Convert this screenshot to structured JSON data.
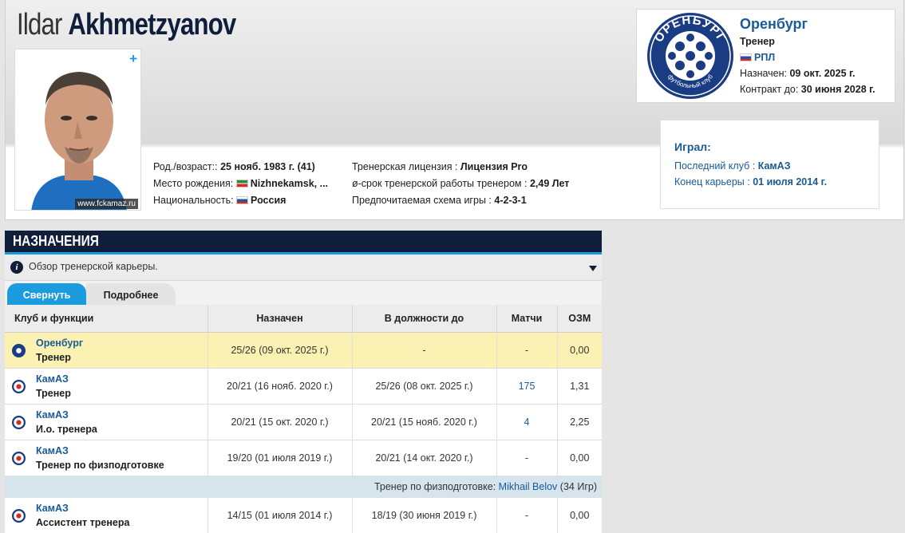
{
  "coach": {
    "first_name": "Ildar",
    "last_name": "Akhmetzyanov",
    "photo_credit": "www.fckamaz.ru",
    "plus": "+"
  },
  "info_left": [
    {
      "label": "Род./возраст::",
      "value": "25 нояб. 1983 г. (41)",
      "flag": ""
    },
    {
      "label": "Место рождения:",
      "value": "Nizhnekamsk, ...",
      "flag": "tatarstan-flag"
    },
    {
      "label": "Национальность:",
      "value": "Россия",
      "flag": "russia-flag"
    }
  ],
  "info_right": [
    {
      "label": "Тренерская лицензия :",
      "value": "Лицензия Pro"
    },
    {
      "label": "ø-срок тренерской работы тренером :",
      "value": "2,49 Лет"
    },
    {
      "label": "Предпочитаемая схема игры :",
      "value": "4-2-3-1"
    }
  ],
  "current_club": {
    "name": "Оренбург",
    "role": "Тренер",
    "league": "РПЛ",
    "appointed_label": "Назначен:",
    "appointed": "09 окт. 2025 г.",
    "contract_label": "Контракт до:",
    "contract": "30 июня 2028 г.",
    "logo_text_top": "ОРЕНБУРГ",
    "logo_text_bottom": "футбольный клуб",
    "logo_year_left": "19",
    "logo_year_right": "76"
  },
  "played": {
    "title": "Играл:",
    "last_club_label": "Последний клуб :",
    "last_club": "КамАЗ",
    "career_end_label": "Конец карьеры :",
    "career_end": "01 июля 2014 г."
  },
  "section": {
    "title": "НАЗНАЧЕНИЯ",
    "overview": "Обзор тренерской карьеры.",
    "tab_collapse": "Свернуть",
    "tab_more": "Подробнее"
  },
  "table": {
    "headers": [
      "Клуб и функции",
      "Назначен",
      "В должности до",
      "Матчи",
      "ОЗМ"
    ],
    "rows": [
      {
        "club": "Оренбург",
        "role": "Тренер",
        "appointed": "25/26 (09 окт. 2025 г.)",
        "until": "-",
        "matches": "-",
        "ppm": "0,00"
      },
      {
        "club": "КамАЗ",
        "role": "Тренер",
        "appointed": "20/21 (16 нояб. 2020 г.)",
        "until": "25/26 (08 окт. 2025 г.)",
        "matches": "175",
        "ppm": "1,31"
      },
      {
        "club": "КамАЗ",
        "role": "И.о. тренера",
        "appointed": "20/21 (15 окт. 2020 г.)",
        "until": "20/21 (15 нояб. 2020 г.)",
        "matches": "4",
        "ppm": "2,25"
      },
      {
        "club": "КамАЗ",
        "role": "Тренер по физподготовке",
        "appointed": "19/20 (01 июля 2019 г.)",
        "until": "20/21 (14 окт. 2020 г.)",
        "matches": "-",
        "ppm": "0,00"
      },
      {
        "club": "КамАЗ",
        "role": "Ассистент тренера",
        "appointed": "14/15 (01 июля 2014 г.)",
        "until": "18/19 (30 июня 2019 г.)",
        "matches": "-",
        "ppm": "0,00"
      }
    ],
    "note": {
      "prefix": "Тренер по физподготовке:",
      "name": "Mikhail Belov",
      "suffix": "(34 Игр)"
    }
  },
  "colors": {
    "navy": "#0f1e3a",
    "accent": "#1a9cdf",
    "link": "#1a5a96",
    "highlight": "#fbf1b3"
  }
}
